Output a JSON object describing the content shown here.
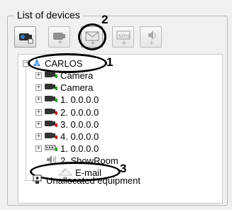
{
  "group": {
    "title": "List of devices"
  },
  "toolbar": {
    "buttons": [
      {
        "name": "camera-search-button",
        "icon": "camera-search-icon",
        "enabled": true
      },
      {
        "name": "add-camera-button",
        "icon": "add-camera-icon",
        "enabled": false
      },
      {
        "name": "add-email-button",
        "icon": "add-email-icon",
        "enabled": true
      },
      {
        "name": "add-sms-button",
        "icon": "add-sms-icon",
        "enabled": false,
        "label": "sms"
      },
      {
        "name": "add-sound-button",
        "icon": "add-sound-icon",
        "enabled": false
      }
    ]
  },
  "tree": {
    "root": {
      "label": "CARLOS",
      "expander": "−"
    },
    "items": [
      {
        "label": "Camera",
        "icon": "camera-icon",
        "expander": "+"
      },
      {
        "label": "Camera",
        "icon": "camera-icon",
        "expander": "+"
      },
      {
        "label": "1. 0.0.0.0",
        "icon": "camera-icon",
        "expander": "+"
      },
      {
        "label": "2. 0.0.0.0",
        "icon": "camera-icon",
        "expander": "+"
      },
      {
        "label": "3. 0.0.0.0",
        "icon": "camera-icon",
        "expander": "+"
      },
      {
        "label": "4. 0.0.0.0",
        "icon": "camera-icon",
        "expander": "+"
      },
      {
        "label": "1. 0.0.0.0",
        "icon": "device-board-icon",
        "expander": "+"
      },
      {
        "label": "2. ShowRoom",
        "icon": "speaker-icon",
        "expander": ""
      },
      {
        "label": "E-mail",
        "icon": "email-icon",
        "expander": ""
      }
    ],
    "unallocated": {
      "label": "Unallocated equipment",
      "icon": "unallocated-equipment-icon"
    }
  },
  "callouts": {
    "one": "1",
    "two": "2",
    "three": "3"
  },
  "colors": {
    "status_green": "#1fa81f",
    "status_red": "#d41a1a",
    "root_icon": "#2a7fd4"
  }
}
